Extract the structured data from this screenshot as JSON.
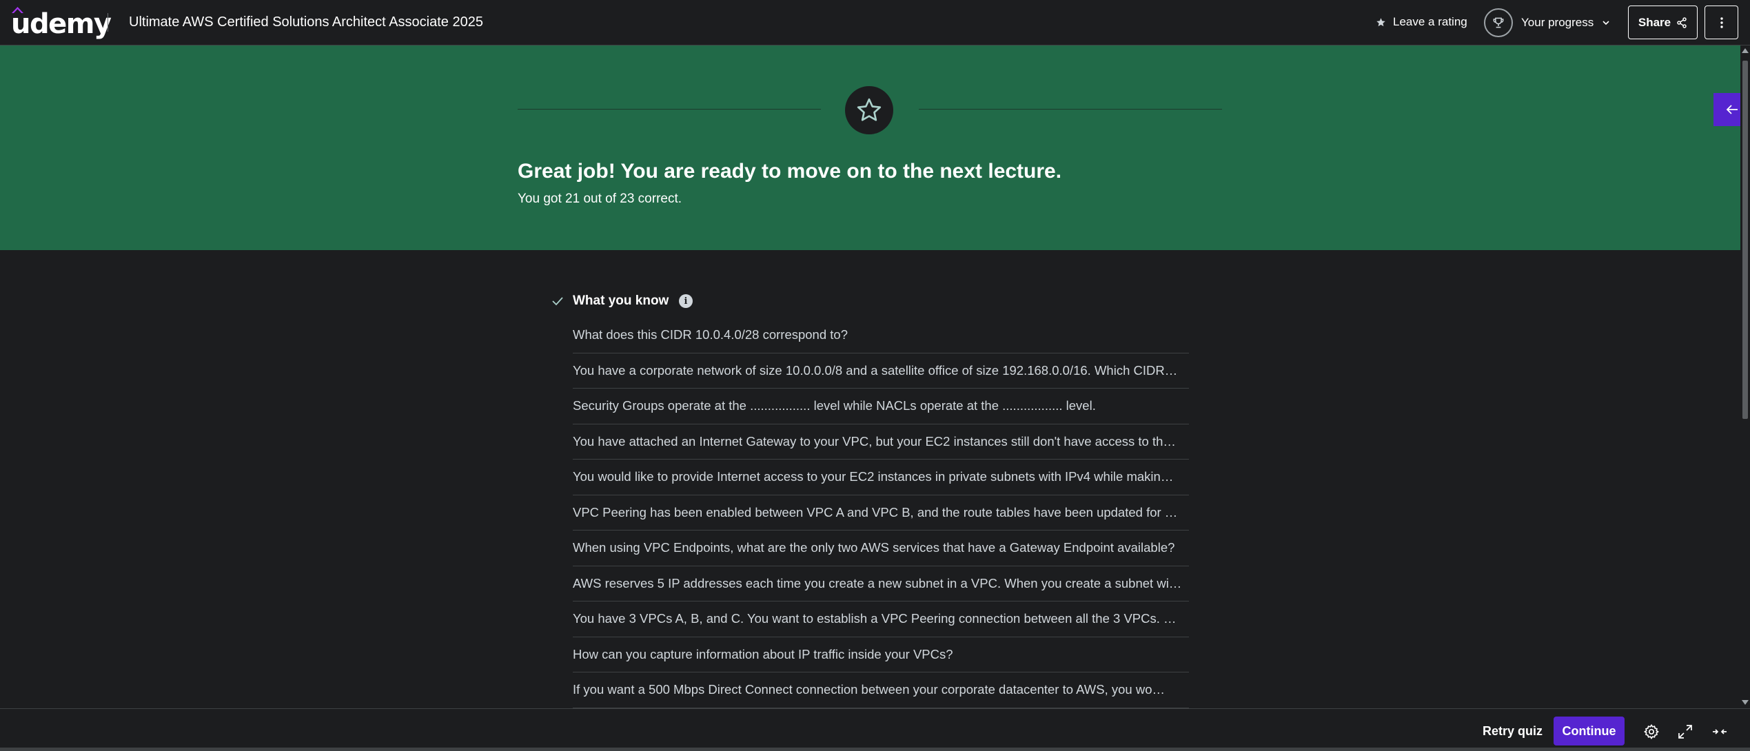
{
  "header": {
    "logo": "udemy",
    "course_title": "Ultimate AWS Certified Solutions Architect Associate 2025",
    "rating_label": "Leave a rating",
    "progress_label": "Your progress",
    "share_label": "Share"
  },
  "banner": {
    "title": "Great job! You are ready to move on to the next lecture.",
    "subtitle": "You got 21 out of 23 correct."
  },
  "knowledge": {
    "heading": "What you know",
    "questions": [
      "What does this CIDR 10.0.4.0/28 correspond to?",
      "You have a corporate network of size 10.0.0.0/8 and a satellite office of size 192.168.0.0/16. Which CIDR…",
      "Security Groups operate at the ................. level while NACLs operate at the ................. level.",
      "You have attached an Internet Gateway to your VPC, but your EC2 instances still don't have access to th…",
      "You would like to provide Internet access to your EC2 instances in private subnets with IPv4 while makin…",
      "VPC Peering has been enabled between VPC A and VPC B, and the route tables have been updated for …",
      "When using VPC Endpoints, what are the only two AWS services that have a Gateway Endpoint available?",
      "AWS reserves 5 IP addresses each time you create a new subnet in a VPC. When you create a subnet wi…",
      "You have 3 VPCs A, B, and C. You want to establish a VPC Peering connection between all the 3 VPCs. …",
      "How can you capture information about IP traffic inside your VPCs?",
      "If you want a 500 Mbps Direct Connect connection between your corporate datacenter to AWS, you wo…"
    ]
  },
  "footer": {
    "retry_label": "Retry quiz",
    "continue_label": "Continue"
  },
  "colors": {
    "banner_green": "#216a48",
    "brand_purple": "#5624d0",
    "background": "#1c1d1f"
  },
  "icons": [
    "udemy-logo",
    "star-icon",
    "trophy-icon",
    "chevron-down-icon",
    "share-icon",
    "more-vertical-icon",
    "arrow-left-icon",
    "check-icon",
    "info-icon",
    "settings-icon",
    "fullscreen-icon",
    "collapse-icon"
  ]
}
